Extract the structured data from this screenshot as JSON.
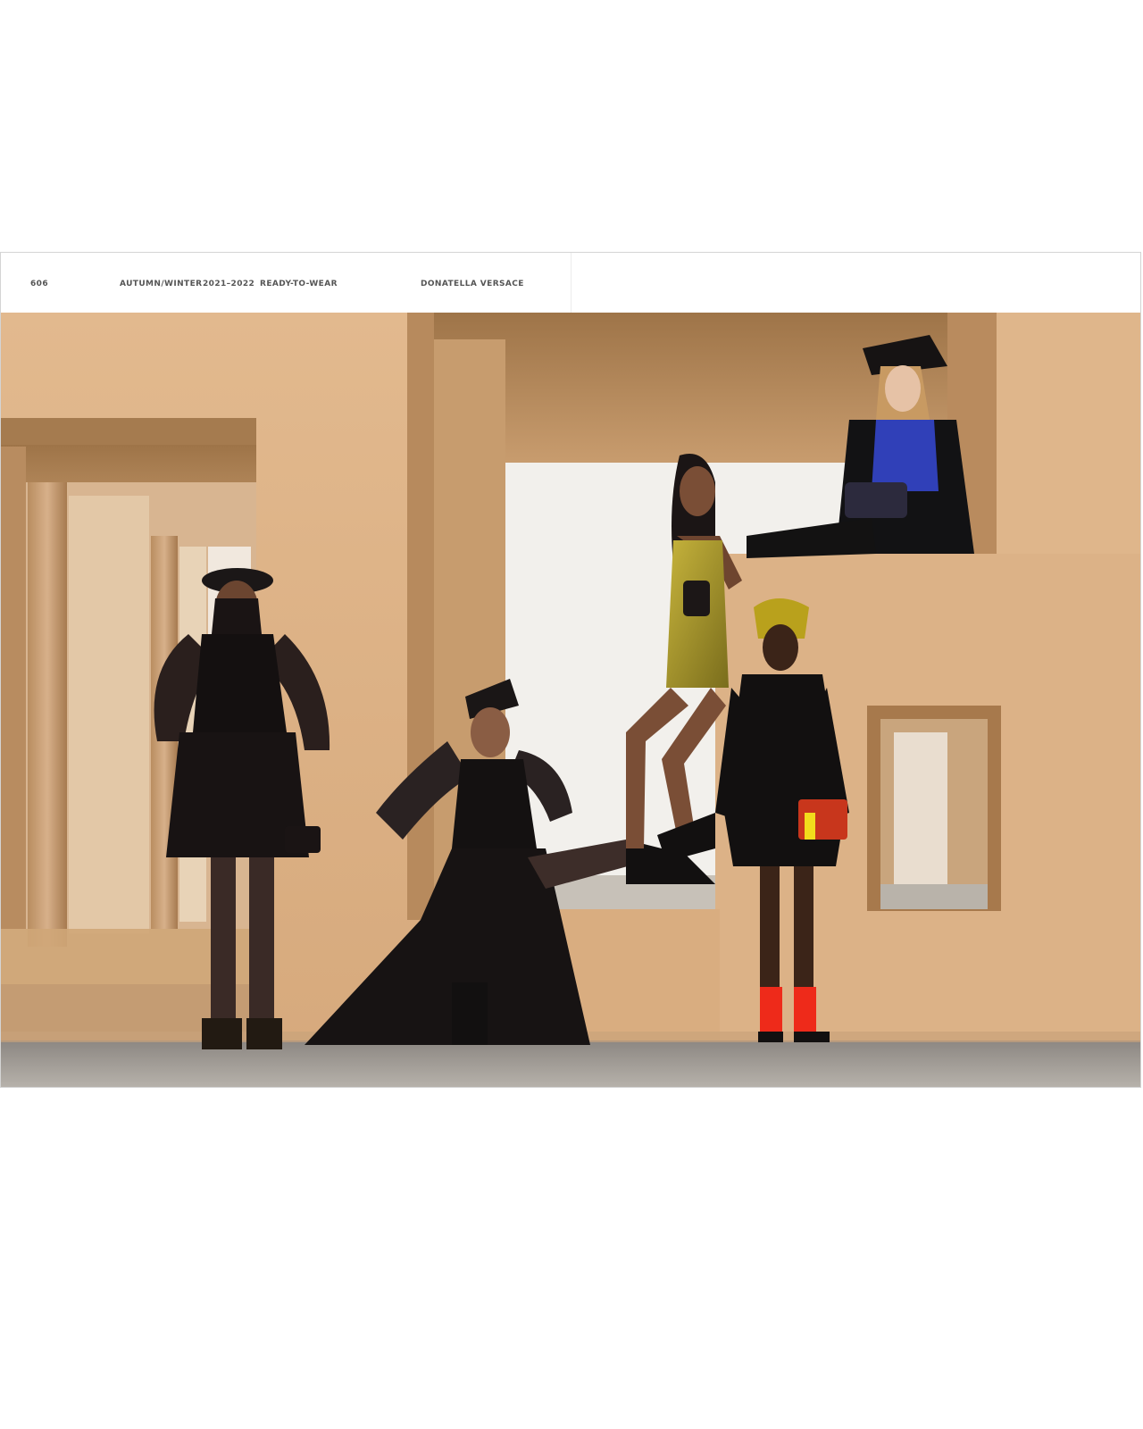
{
  "header": {
    "page_number": "606",
    "season": "AUTUMN/WINTER",
    "years": "2021–2022",
    "collection_type": "READY-TO-WEAR",
    "designer": "DONATELLA VERSACE"
  },
  "photo": {
    "subject": "campaign-photograph",
    "colors": {
      "wall": "#d9ae82",
      "floor": "#9a9590",
      "sky": "#f3f1ee"
    }
  }
}
